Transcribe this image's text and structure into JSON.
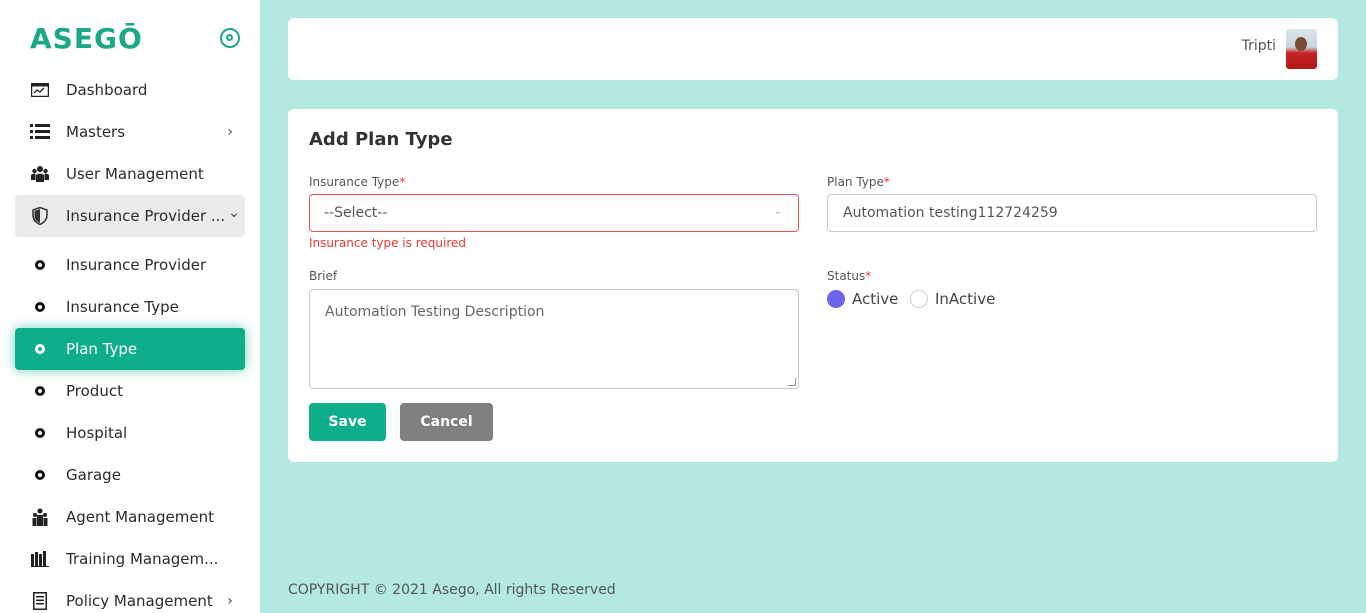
{
  "brand": {
    "logo_text": "ASEGŌ"
  },
  "sidebar": {
    "items": [
      {
        "label": "Dashboard",
        "icon": "dashboard-icon"
      },
      {
        "label": "Masters",
        "icon": "list-icon",
        "chevron": "›"
      },
      {
        "label": "User Management",
        "icon": "users-icon"
      },
      {
        "label": "Insurance Provider ...",
        "icon": "shield-icon",
        "chevron": "⌄"
      },
      {
        "label": "Insurance Provider",
        "icon": "bullet-icon"
      },
      {
        "label": "Insurance Type",
        "icon": "bullet-icon"
      },
      {
        "label": "Plan Type",
        "icon": "bullet-icon",
        "active": true
      },
      {
        "label": "Product",
        "icon": "bullet-icon"
      },
      {
        "label": "Hospital",
        "icon": "bullet-icon"
      },
      {
        "label": "Garage",
        "icon": "bullet-icon"
      },
      {
        "label": "Agent Management",
        "icon": "agent-icon"
      },
      {
        "label": "Training Managem...",
        "icon": "books-icon"
      },
      {
        "label": "Policy Management",
        "icon": "document-icon",
        "chevron": "›"
      }
    ]
  },
  "header": {
    "user_name": "Tripti"
  },
  "form": {
    "title": "Add Plan Type",
    "insurance_type": {
      "label": "Insurance Type",
      "required_mark": "*",
      "value": "--Select--",
      "error": "Insurance type is required"
    },
    "plan_type": {
      "label": "Plan Type",
      "required_mark": "*",
      "value": "Automation testing112724259"
    },
    "brief": {
      "label": "Brief",
      "value": "Automation Testing Description"
    },
    "status": {
      "label": "Status",
      "required_mark": "*",
      "options": [
        "Active",
        "InActive"
      ],
      "selected": "Active"
    },
    "save_label": "Save",
    "cancel_label": "Cancel"
  },
  "footer": {
    "text": "COPYRIGHT © 2021 Asego, All rights Reserved"
  },
  "colors": {
    "accent": "#0fae8b",
    "background": "#b3e9e1",
    "error": "#e53935",
    "radio_selected": "#6f63e8",
    "cancel": "#7d7f81"
  }
}
